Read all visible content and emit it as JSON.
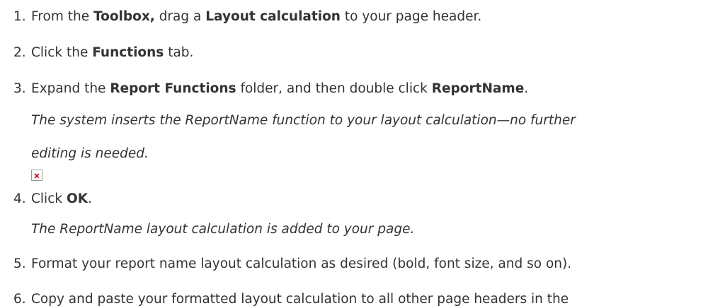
{
  "steps": [
    {
      "number": "1.",
      "parts": [
        "From the ",
        "Toolbox,",
        " drag a ",
        "Layout calculation",
        " to your page header."
      ]
    },
    {
      "number": "2.",
      "parts": [
        "Click the ",
        "Functions",
        " tab."
      ]
    },
    {
      "number": "3.",
      "parts": [
        "Expand the ",
        "Report Functions",
        " folder, and then double click ",
        "ReportName",
        "."
      ],
      "note_line1": "The system inserts the ReportName function to your layout calculation—no further",
      "note_line2": "editing is needed."
    },
    {
      "number": "4.",
      "parts": [
        "Click ",
        "OK",
        "."
      ],
      "note": "The ReportName layout calculation is added to your page."
    },
    {
      "number": "5.",
      "text": "Format your report name layout calculation as desired (bold, font size, and so on)."
    },
    {
      "number": "6.",
      "text": "Copy and paste your formatted layout calculation to all other page headers in the"
    }
  ],
  "broken_image_icon": "broken-image-icon"
}
